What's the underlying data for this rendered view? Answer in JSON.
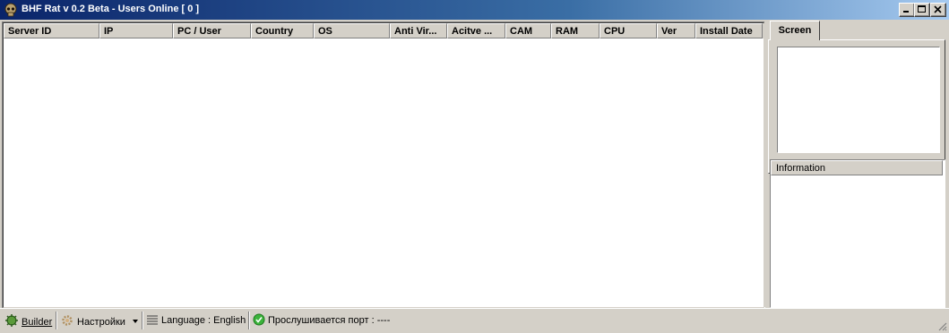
{
  "window": {
    "title": "BHF Rat v 0.2 Beta - Users Online [ 0 ]",
    "icon": "skull-icon",
    "controls": [
      "minimize-icon",
      "maximize-icon",
      "close-icon"
    ]
  },
  "list": {
    "columns": [
      "Server ID",
      "IP",
      "PC / User",
      "Country",
      "OS",
      "Anti Vir...",
      "Acitve ...",
      "CAM",
      "RAM",
      "CPU",
      "Ver",
      "Install Date"
    ],
    "rows": []
  },
  "right_panel": {
    "tab_label": "Screen",
    "info_header": "Information"
  },
  "statusbar": {
    "builder_label": "Builder",
    "settings_label": "Настройки",
    "language_label": "Language : English",
    "port_label": "Прослушивается порт : ----"
  },
  "colors": {
    "title_gradient_start": "#0a246a",
    "title_gradient_end": "#a6caf0",
    "face": "#d4d0c8",
    "status_ok": "#3bb33b"
  }
}
